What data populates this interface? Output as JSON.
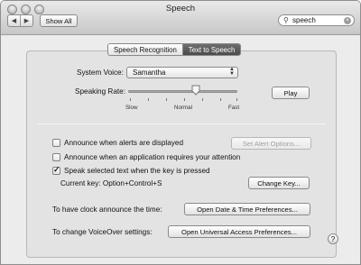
{
  "window": {
    "title": "Speech"
  },
  "toolbar": {
    "back": "◀",
    "forward": "▶",
    "show_all": "Show All"
  },
  "search": {
    "value": "speech"
  },
  "tabs": [
    {
      "label": "Speech Recognition",
      "active": false
    },
    {
      "label": "Text to Speech",
      "active": true
    }
  ],
  "voice": {
    "label": "System Voice:",
    "value": "Samantha"
  },
  "rate": {
    "label": "Speaking Rate:",
    "slow": "Slow",
    "normal": "Normal",
    "fast": "Fast",
    "level": 0.62,
    "play": "Play"
  },
  "options": {
    "alerts": {
      "label": "Announce when alerts are displayed",
      "checked": false,
      "button": "Set Alert Options..."
    },
    "attention": {
      "label": "Announce when an application requires your attention",
      "checked": false
    },
    "speak_selected": {
      "label": "Speak selected text when the key is pressed",
      "checked": true
    },
    "current_key": "Current key: Option+Control+S",
    "change_key": "Change Key..."
  },
  "clock": {
    "label": "To have clock announce the time:",
    "button": "Open Date & Time Preferences..."
  },
  "voiceover": {
    "label": "To change VoiceOver settings:",
    "button": "Open Universal Access Preferences..."
  },
  "help": "?",
  "colors": {
    "active_tab": "#555555",
    "panel": "#e3e3e3"
  }
}
